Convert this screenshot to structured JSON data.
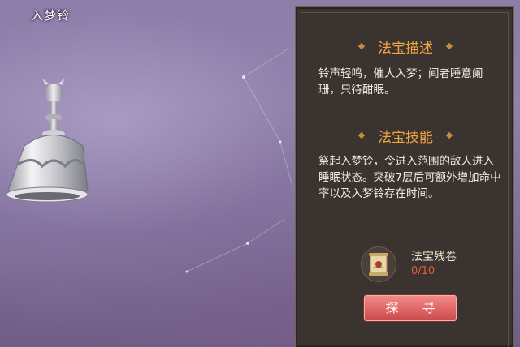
{
  "item_title": "入梦铃",
  "panel": {
    "desc_heading": "法宝描述",
    "desc_text": "铃声轻鸣，催人入梦；闻者睡意阑珊，只待酣眠。",
    "skill_heading": "法宝技能",
    "skill_text": "祭起入梦铃，令进入范围的敌人进入睡眠状态。突破7层后可额外增加命中率以及入梦铃存在时间。",
    "material_name": "法宝残卷",
    "material_count": "0/10",
    "search_button": "探 寻"
  },
  "colors": {
    "heading": "#f2a640",
    "count": "#e55a3a",
    "button": "#e06565",
    "panel_bg": "#3a3330"
  },
  "icons": {
    "bell": "bell-artifact-icon",
    "scroll": "scroll-fragment-icon"
  }
}
